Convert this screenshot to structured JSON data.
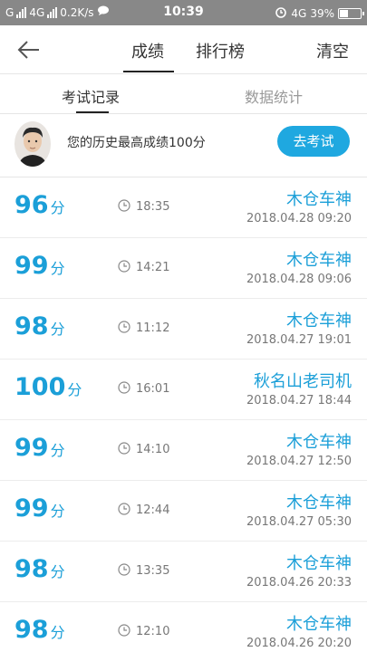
{
  "status_bar": {
    "carrier1": "G",
    "carrier2": "4G",
    "speed": "0.2K/s",
    "time": "10:39",
    "network": "4G",
    "battery": "39%",
    "battery_level": 0.39
  },
  "nav": {
    "tabs": [
      "成绩",
      "排行榜"
    ],
    "active_tab": 0,
    "clear_label": "清空"
  },
  "sub_tabs": {
    "items": [
      "考试记录",
      "数据统计"
    ],
    "active": 0
  },
  "best": {
    "text": "您的历史最高成绩100分",
    "button": "去考试"
  },
  "records": [
    {
      "score": "96",
      "unit": "分",
      "time": "18:35",
      "name": "木仓车神",
      "date": "2018.04.28  09:20"
    },
    {
      "score": "99",
      "unit": "分",
      "time": "14:21",
      "name": "木仓车神",
      "date": "2018.04.28  09:06"
    },
    {
      "score": "98",
      "unit": "分",
      "time": "11:12",
      "name": "木仓车神",
      "date": "2018.04.27  19:01"
    },
    {
      "score": "100",
      "unit": "分",
      "time": "16:01",
      "name": "秋名山老司机",
      "date": "2018.04.27  18:44"
    },
    {
      "score": "99",
      "unit": "分",
      "time": "14:10",
      "name": "木仓车神",
      "date": "2018.04.27  12:50"
    },
    {
      "score": "99",
      "unit": "分",
      "time": "12:44",
      "name": "木仓车神",
      "date": "2018.04.27  05:30"
    },
    {
      "score": "98",
      "unit": "分",
      "time": "13:35",
      "name": "木仓车神",
      "date": "2018.04.26  20:33"
    },
    {
      "score": "98",
      "unit": "分",
      "time": "12:10",
      "name": "木仓车神",
      "date": "2018.04.26  20:20"
    }
  ]
}
